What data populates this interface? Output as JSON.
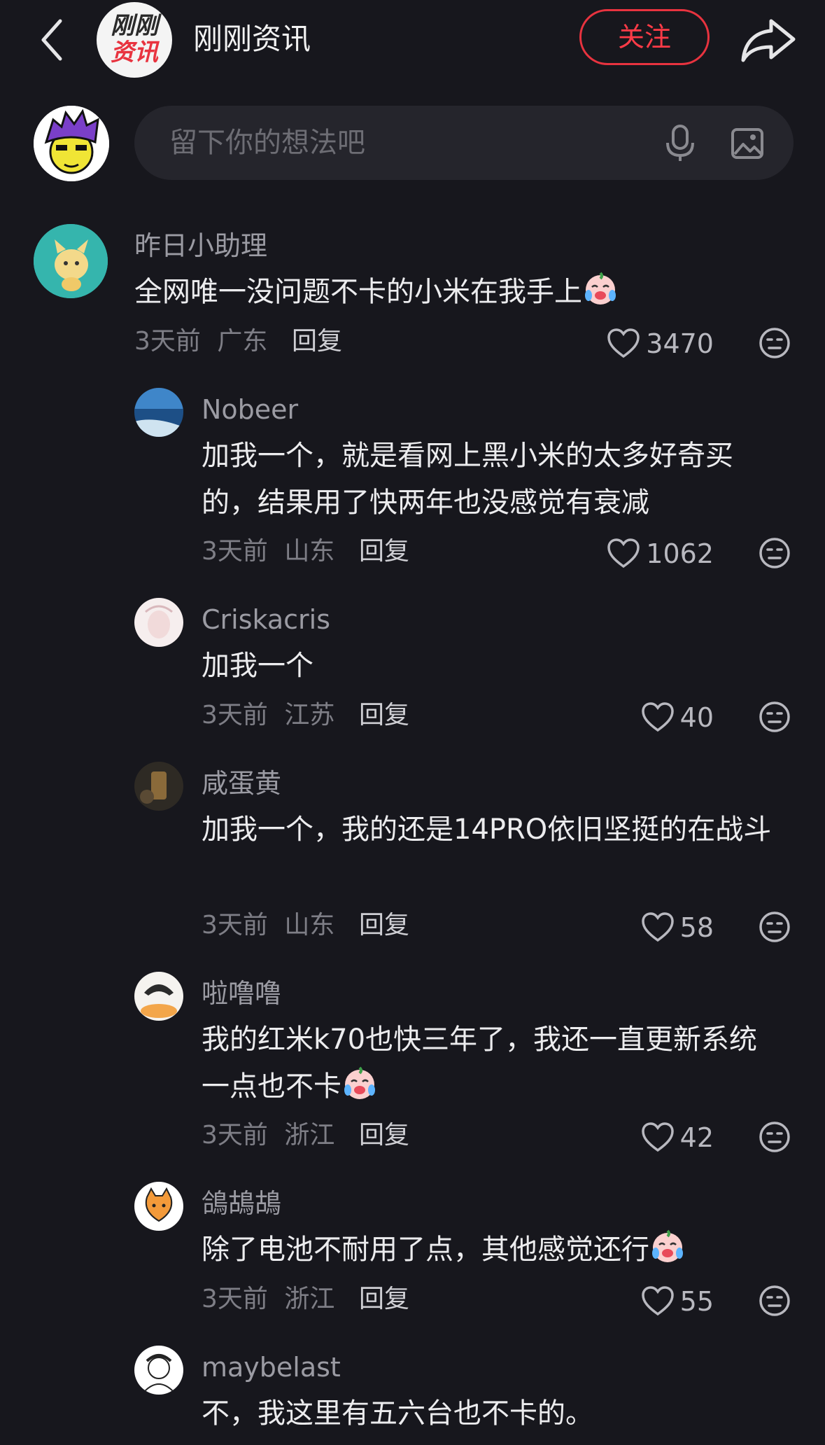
{
  "header": {
    "channel_logo_top": "刚刚",
    "channel_logo_bottom": "资讯",
    "channel_name": "刚刚资讯",
    "follow_label": "关注",
    "accent_color": "#e8333f"
  },
  "comment_box": {
    "placeholder": "留下你的想法吧"
  },
  "comments": [
    {
      "username": "昨日小助理",
      "text": "全网唯一没问题不卡的小米在我手上",
      "emoji": "crying-laughing-emoji",
      "time": "3天前",
      "location": "广东",
      "reply_label": "回复",
      "likes": "3470"
    },
    {
      "username": "Nobeer",
      "text": "加我一个，就是看网上黑小米的太多好奇买的，结果用了快两年也没感觉有衰减",
      "time": "3天前",
      "location": "山东",
      "reply_label": "回复",
      "likes": "1062"
    },
    {
      "username": "Criskacris",
      "text": "加我一个",
      "time": "3天前",
      "location": "江苏",
      "reply_label": "回复",
      "likes": "40"
    },
    {
      "username": "咸蛋黄",
      "text": "加我一个，我的还是14PRO依旧坚挺的在战斗",
      "time": "3天前",
      "location": "山东",
      "reply_label": "回复",
      "likes": "58"
    },
    {
      "username": "啦噜噜",
      "text": "我的红米k70也快三年了，我还一直更新系统一点也不卡",
      "emoji": "crying-laughing-emoji",
      "time": "3天前",
      "location": "浙江",
      "reply_label": "回复",
      "likes": "42"
    },
    {
      "username": "鴿鴣鴣",
      "text": "除了电池不耐用了点，其他感觉还行",
      "emoji": "crying-laughing-emoji",
      "time": "3天前",
      "location": "浙江",
      "reply_label": "回复",
      "likes": "55"
    },
    {
      "username": "maybelast",
      "text": "不，我这里有五六台也不卡的。"
    }
  ]
}
